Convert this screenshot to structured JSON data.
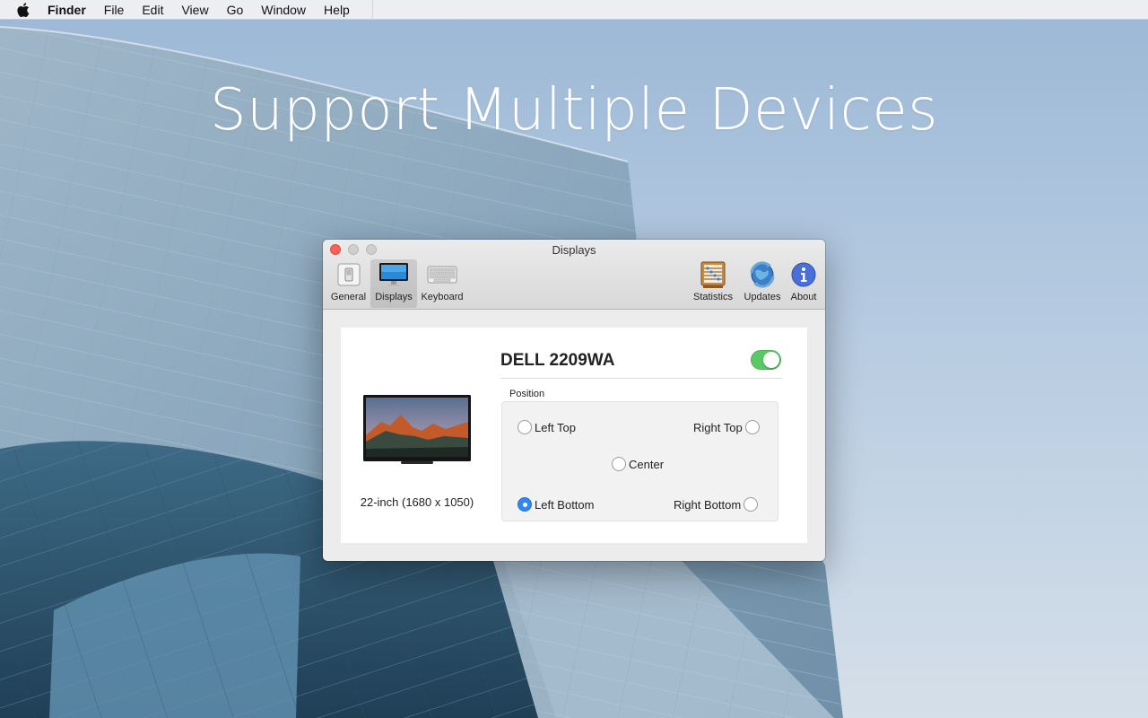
{
  "menubar": {
    "app_name": "Finder",
    "items": [
      "File",
      "Edit",
      "View",
      "Go",
      "Window",
      "Help"
    ]
  },
  "headline": "Support Multiple Devices",
  "window": {
    "title": "Displays",
    "toolbar": {
      "general": "General",
      "displays": "Displays",
      "keyboard": "Keyboard",
      "statistics": "Statistics",
      "updates": "Updates",
      "about": "About"
    },
    "display": {
      "name": "DELL 2209WA",
      "enabled": true,
      "resolution": "22-inch (1680 x 1050)"
    },
    "position": {
      "label": "Position",
      "options": {
        "left_top": "Left Top",
        "right_top": "Right Top",
        "center": "Center",
        "left_bottom": "Left Bottom",
        "right_bottom": "Right Bottom"
      },
      "selected": "Left Bottom"
    }
  },
  "colors": {
    "toggle_on": "#5ac864",
    "radio_selected": "#2f86f5",
    "close_button": "#fc605c"
  }
}
